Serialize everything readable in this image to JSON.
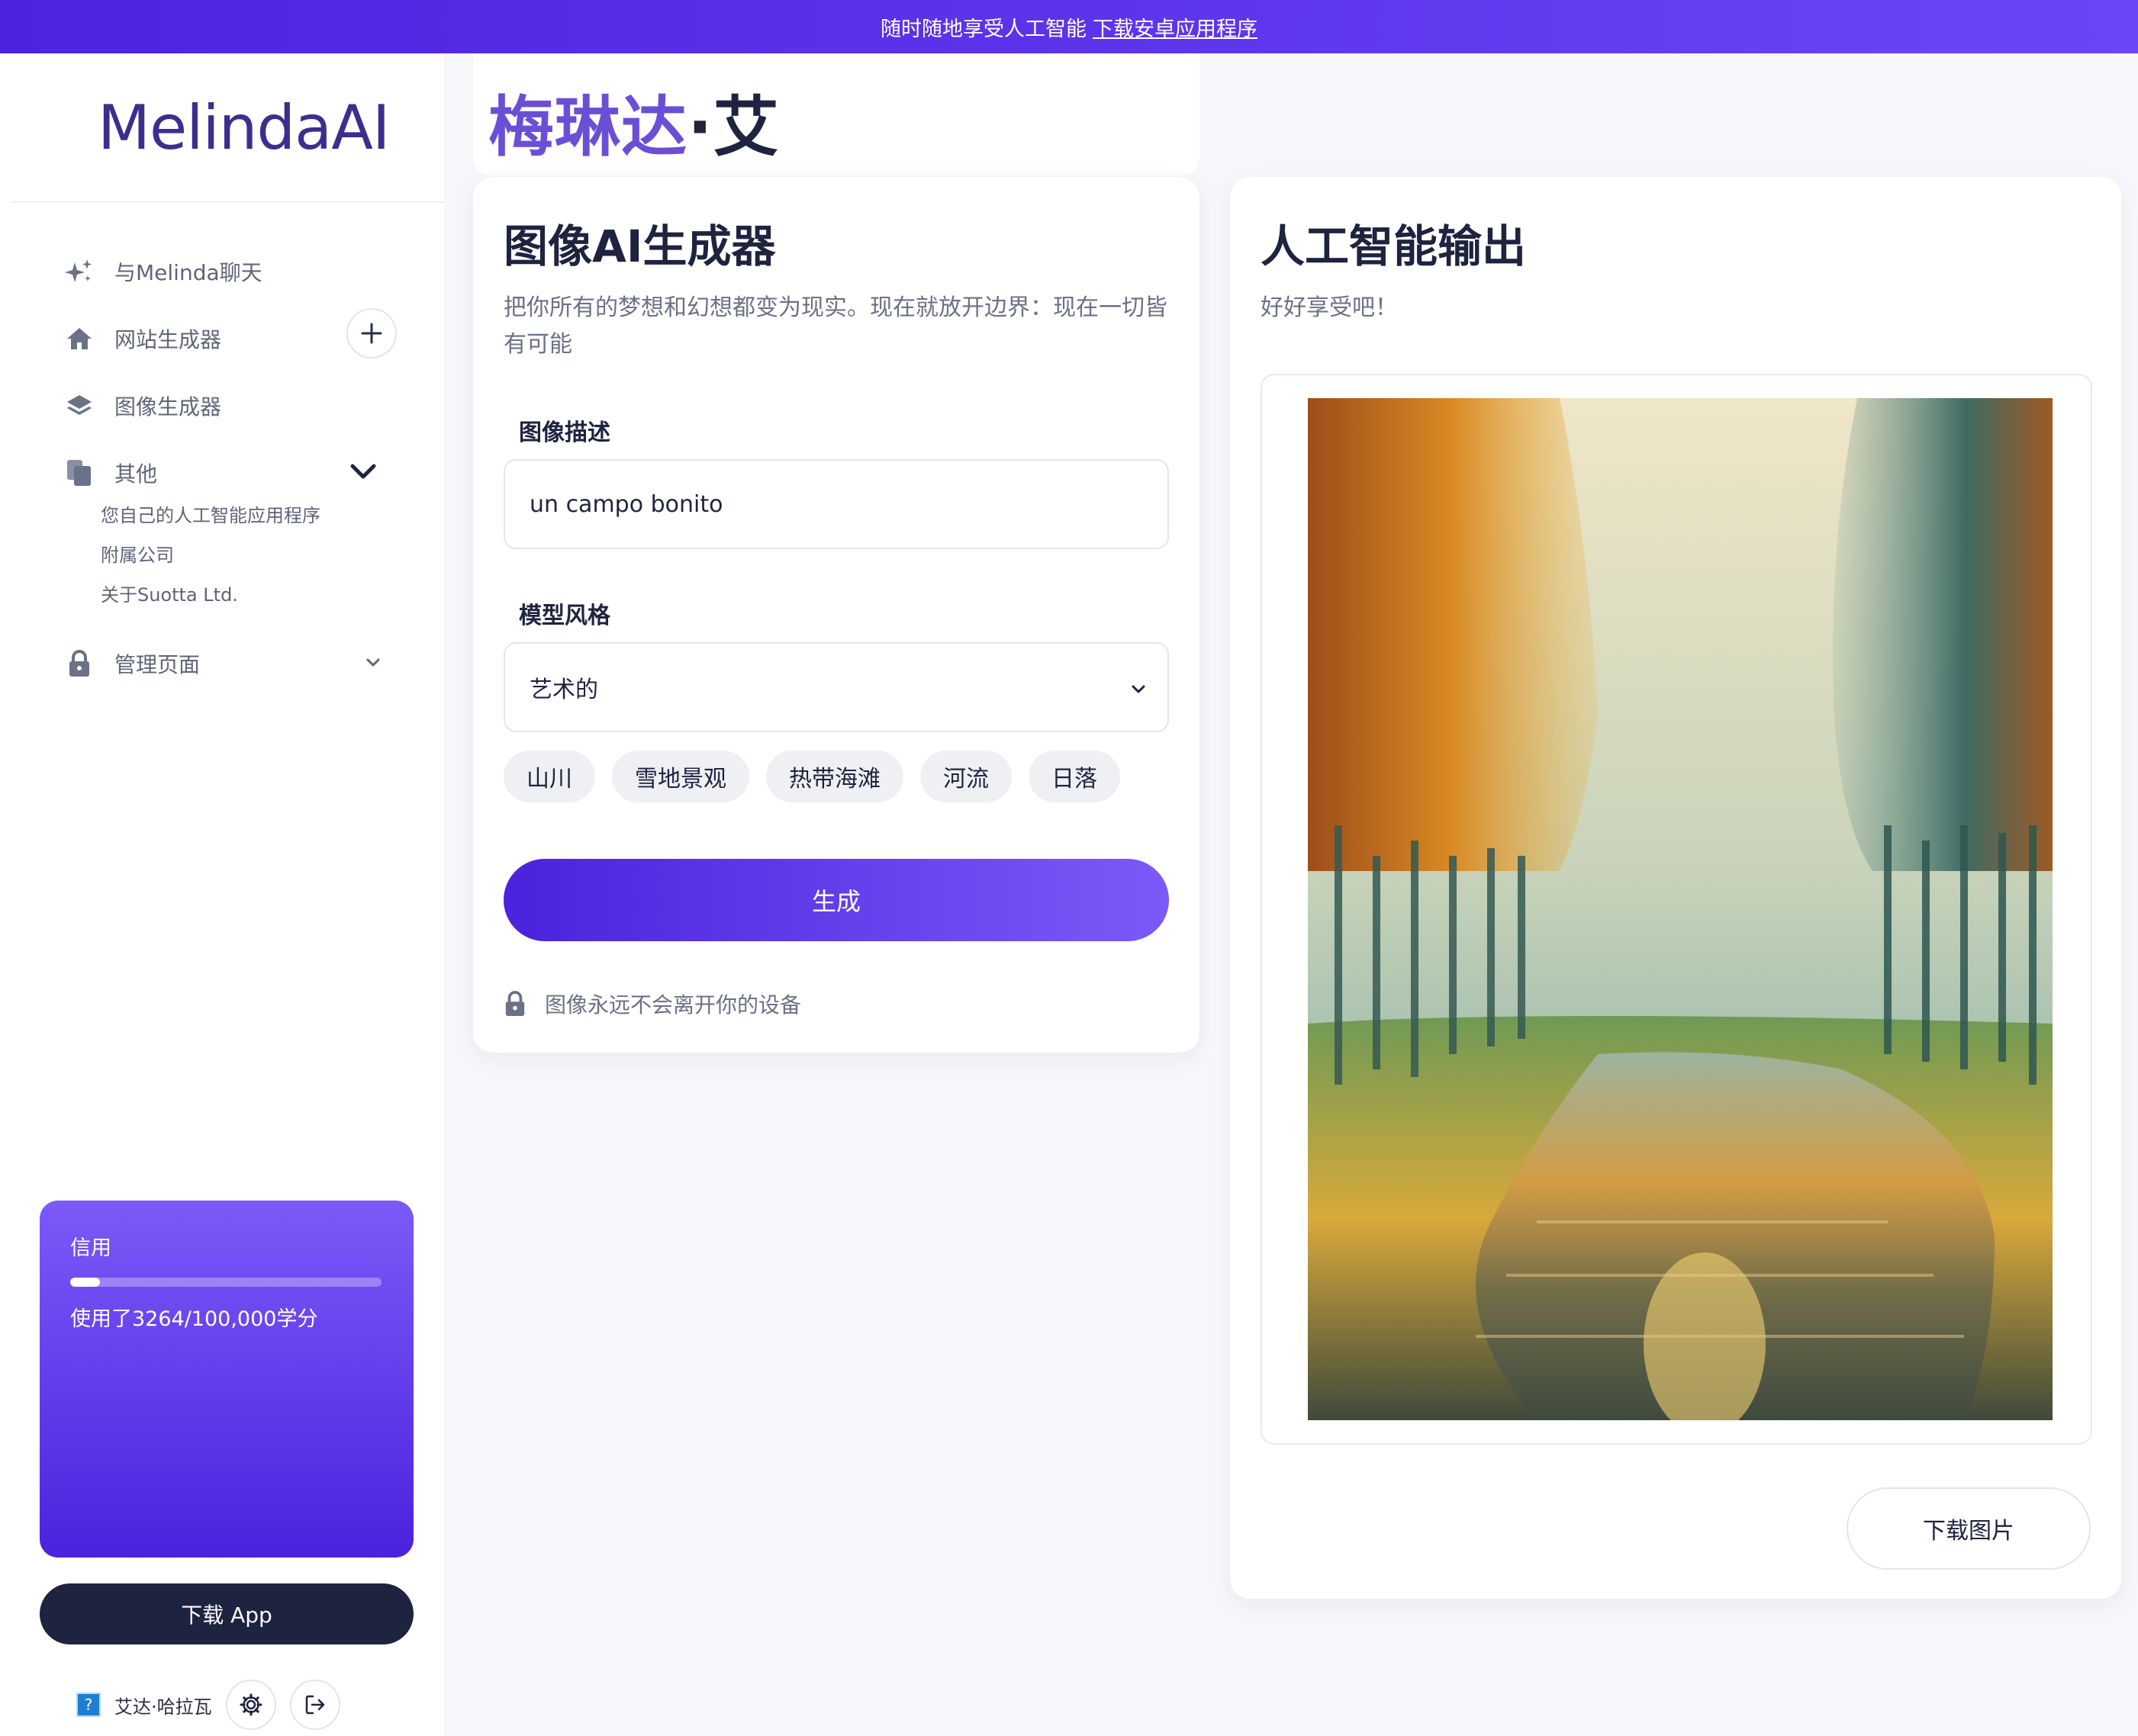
{
  "banner": {
    "text": "随时随地享受人工智能",
    "link": "下载安卓应用程序"
  },
  "sidebar": {
    "logo": "MelindaAI",
    "items": [
      {
        "label": "与Melinda聊天",
        "icon": "sparkles-icon"
      },
      {
        "label": "网站生成器",
        "icon": "home-icon"
      },
      {
        "label": "图像生成器",
        "icon": "layers-icon"
      },
      {
        "label": "其他",
        "icon": "copy-icon"
      },
      {
        "label": "管理页面",
        "icon": "lock-icon"
      }
    ],
    "sub_items": [
      "您自己的人工智能应用程序",
      "附属公司",
      "关于Suotta Ltd."
    ]
  },
  "credits": {
    "title": "信用",
    "used_text": "使用了3264/100,000学分",
    "used_fraction": 0.03264
  },
  "download_app": "下载 App",
  "user": {
    "avatar_text": "?",
    "name": "艾达·哈拉瓦"
  },
  "header": {
    "title_main": "梅琳达",
    "title_rest": "·艾"
  },
  "generator": {
    "title": "图像AI生成器",
    "desc": "把你所有的梦想和幻想都变为现实。现在就放开边界：现在一切皆有可能",
    "desc_label": "图像描述",
    "desc_value": "un campo bonito",
    "style_label": "模型风格",
    "style_value": "艺术的",
    "chips": [
      "山川",
      "雪地景观",
      "热带海滩",
      "河流",
      "日落"
    ],
    "generate": "生成",
    "privacy": "图像永远不会离开你的设备"
  },
  "output": {
    "title": "人工智能输出",
    "subtitle": "好好享受吧！",
    "download": "下载图片"
  },
  "colors": {
    "accent": "#5b33e8",
    "dark": "#1e2340"
  }
}
